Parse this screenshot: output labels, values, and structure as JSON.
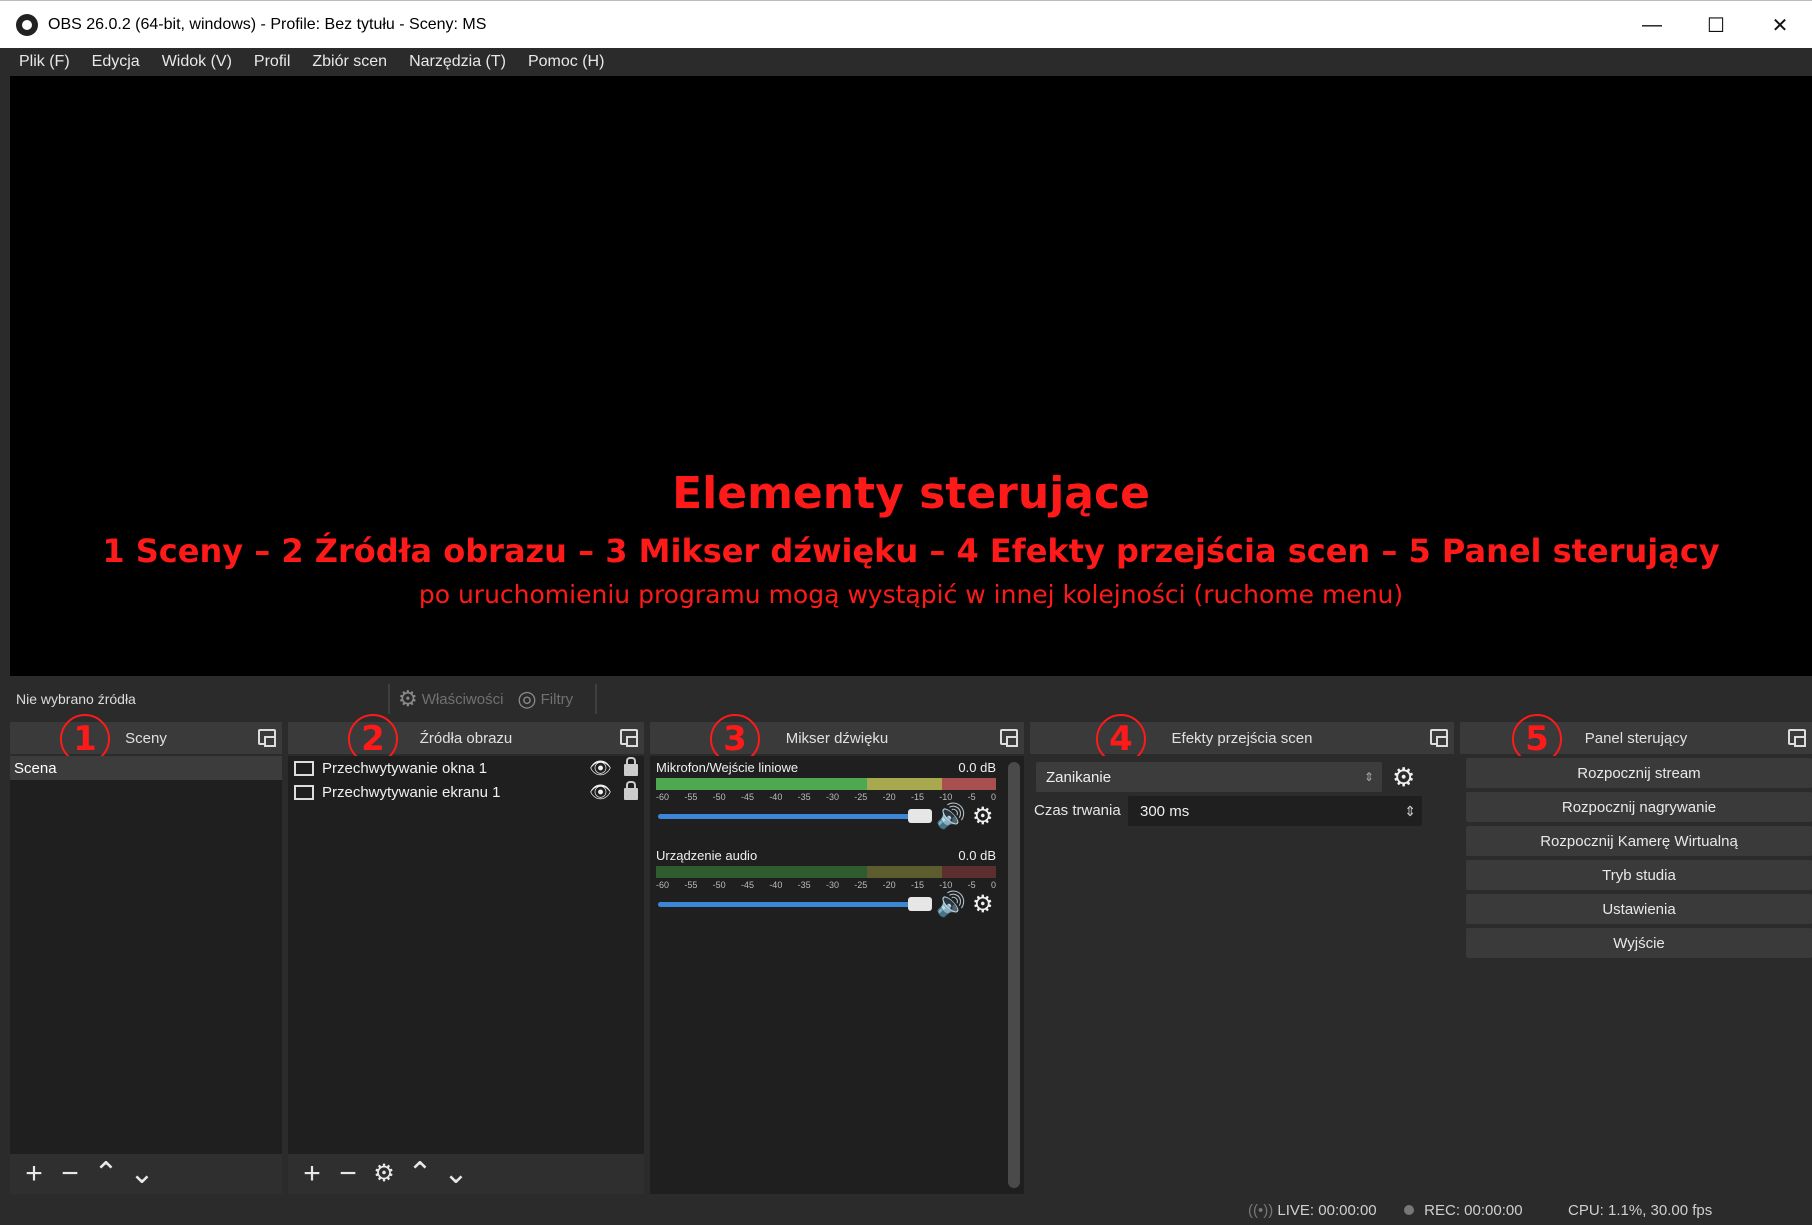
{
  "window": {
    "title": "OBS 26.0.2 (64-bit, windows) - Profile: Bez tytułu - Sceny: MS",
    "minimize": "—",
    "maximize": "☐",
    "close": "✕"
  },
  "menu": [
    "Plik (F)",
    "Edycja",
    "Widok (V)",
    "Profil",
    "Zbiór scen",
    "Narzędzia (T)",
    "Pomoc (H)"
  ],
  "overlay": {
    "title": "Elementy sterujące",
    "line2": "1 Sceny – 2 Źródła obrazu – 3 Mikser dźwięku – 4 Efekty przejścia scen – 5 Panel sterujący",
    "line3": "po uruchomieniu programu mogą wystąpić w innej kolejności (ruchome menu)"
  },
  "source_toolbar": {
    "no_source": "Nie wybrano źródła",
    "properties": "Właściwości",
    "filters": "Filtry"
  },
  "scenes": {
    "header": "Sceny",
    "number": "1",
    "items": [
      "Scena"
    ]
  },
  "sources": {
    "header": "Źródła obrazu",
    "number": "2",
    "items": [
      "Przechwytywanie okna 1",
      "Przechwytywanie ekranu 1"
    ]
  },
  "mixer": {
    "header": "Mikser dźwięku",
    "number": "3",
    "channels": [
      {
        "name": "Mikrofon/Wejście liniowe",
        "db": "0.0 dB"
      },
      {
        "name": "Urządzenie audio",
        "db": "0.0 dB"
      }
    ],
    "scale": [
      "-60",
      "-55",
      "-50",
      "-45",
      "-40",
      "-35",
      "-30",
      "-25",
      "-20",
      "-15",
      "-10",
      "-5",
      "0"
    ]
  },
  "transitions": {
    "header": "Efekty przejścia scen",
    "number": "4",
    "selected": "Zanikanie",
    "duration_label": "Czas trwania",
    "duration_value": "300 ms"
  },
  "controls": {
    "header": "Panel sterujący",
    "number": "5",
    "buttons": [
      "Rozpocznij stream",
      "Rozpocznij nagrywanie",
      "Rozpocznij Kamerę Wirtualną",
      "Tryb studia",
      "Ustawienia",
      "Wyjście"
    ]
  },
  "status": {
    "live": "LIVE: 00:00:00",
    "rec": "REC: 00:00:00",
    "cpu": "CPU: 1.1%, 30.00 fps"
  }
}
